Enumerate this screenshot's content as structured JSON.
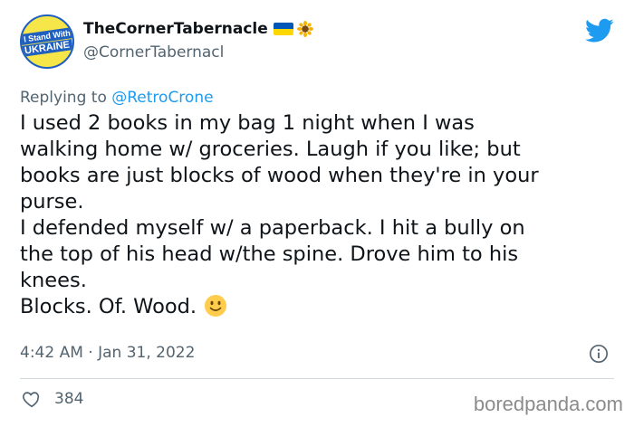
{
  "author": {
    "avatar_text_line1": "I Stand With",
    "avatar_text_line2": "UKRAINE",
    "display_name": "TheCornerTabernacle",
    "handle": "@CornerTabernacl",
    "name_emojis": [
      "ukraine-flag-icon",
      "sunflower-icon"
    ]
  },
  "reply": {
    "prefix": "Replying to",
    "mention": "@RetroCrone"
  },
  "tweet": {
    "lines": [
      "I used 2 books in my bag 1 night when I was",
      "walking home w/ groceries. Laugh if you like; but",
      "books are just blocks of wood when they're in your",
      "purse.",
      "I defended myself w/ a paperback. I hit a bully on",
      "the top of his head w/the spine. Drove him to his",
      "knees.",
      "Blocks. Of. Wood."
    ],
    "timestamp": "4:42 AM · Jan 31, 2022"
  },
  "engagement": {
    "likes": "384"
  },
  "watermark": "boredpanda.com",
  "colors": {
    "accent": "#1d9bf0",
    "secondary_text": "#536471",
    "flag_blue": "#0057b7",
    "flag_yellow": "#ffd700"
  }
}
